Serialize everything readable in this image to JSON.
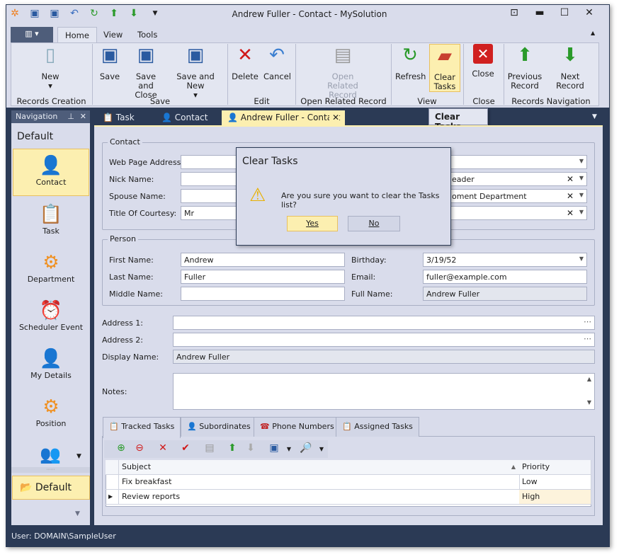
{
  "window": {
    "title": "Andrew Fuller - Contact - MySolution"
  },
  "quick_access": [
    "app-logo-icon",
    "save-icon",
    "save-close-icon",
    "undo-icon",
    "refresh-icon",
    "previous-icon",
    "next-icon",
    "customize-icon"
  ],
  "ribbon": {
    "tabs": [
      {
        "label": "Home",
        "active": true
      },
      {
        "label": "View"
      },
      {
        "label": "Tools"
      }
    ],
    "groups": [
      {
        "label": "Records Creation",
        "buttons": [
          {
            "label": "New",
            "dropdown": true
          }
        ]
      },
      {
        "label": "Save",
        "buttons": [
          {
            "label": "Save"
          },
          {
            "label": "Save and Close"
          },
          {
            "label": "Save and New",
            "dropdown": true
          }
        ]
      },
      {
        "label": "Edit",
        "buttons": [
          {
            "label": "Delete"
          },
          {
            "label": "Cancel"
          }
        ]
      },
      {
        "label": "Open Related Record",
        "buttons": [
          {
            "label": "Open Related Record",
            "disabled": true
          }
        ]
      },
      {
        "label": "View",
        "buttons": [
          {
            "label": "Refresh"
          },
          {
            "label": "Clear Tasks",
            "hover": true
          }
        ]
      },
      {
        "label": "Close",
        "buttons": [
          {
            "label": "Close"
          }
        ]
      },
      {
        "label": "Records Navigation",
        "buttons": [
          {
            "label": "Previous Record"
          },
          {
            "label": "Next Record"
          }
        ]
      }
    ],
    "tooltip": "Clear Tasks"
  },
  "navigation": {
    "title": "Navigation",
    "group": "Default",
    "items": [
      {
        "label": "Contact",
        "selected": true
      },
      {
        "label": "Task"
      },
      {
        "label": "Department"
      },
      {
        "label": "Scheduler Event"
      },
      {
        "label": "My Details"
      },
      {
        "label": "Position"
      }
    ],
    "footer_group": "Default"
  },
  "doc_tabs": [
    {
      "label": "Task"
    },
    {
      "label": "Contact"
    },
    {
      "label": "Andrew Fuller - Contact",
      "active": true
    }
  ],
  "contact": {
    "title": "Contact",
    "fields": [
      {
        "label": "Web Page Address:",
        "value": ""
      },
      {
        "label": "Nick Name:",
        "value": ""
      },
      {
        "label": "Spouse Name:",
        "value": ""
      },
      {
        "label": "Title Of Courtesy:",
        "value": "Mr"
      }
    ],
    "right_values": [
      "",
      "eader",
      "oment Department",
      ""
    ]
  },
  "person": {
    "title": "Person",
    "left": [
      {
        "label": "First Name:",
        "value": "Andrew"
      },
      {
        "label": "Last Name:",
        "value": "Fuller"
      },
      {
        "label": "Middle Name:",
        "value": ""
      }
    ],
    "right": [
      {
        "label": "Birthday:",
        "value": "3/19/52"
      },
      {
        "label": "Email:",
        "value": "fuller@example.com"
      },
      {
        "label": "Full Name:",
        "value": "Andrew Fuller"
      }
    ]
  },
  "address1": {
    "label": "Address 1:",
    "value": ""
  },
  "address2": {
    "label": "Address 2:",
    "value": ""
  },
  "display_name": {
    "label": "Display Name:",
    "value": "Andrew Fuller"
  },
  "notes": {
    "label": "Notes:",
    "value": ""
  },
  "detail_tabs": [
    {
      "label": "Tracked Tasks",
      "active": true
    },
    {
      "label": "Subordinates"
    },
    {
      "label": "Phone Numbers"
    },
    {
      "label": "Assigned Tasks"
    }
  ],
  "grid": {
    "columns": [
      "Subject",
      "Priority"
    ],
    "rows": [
      {
        "subject": "Fix breakfast",
        "priority": "Low"
      },
      {
        "subject": "Review reports",
        "priority": "High",
        "focused": true
      }
    ]
  },
  "dialog": {
    "title": "Clear Tasks",
    "message": "Are you sure you want to clear the Tasks list?",
    "yes": "Yes",
    "no": "No"
  },
  "status": {
    "user": "User: DOMAIN\\SampleUser"
  },
  "colors": {
    "frame": "#2b3a55",
    "highlight": "#fcefb0",
    "background": "#d9dceb"
  }
}
